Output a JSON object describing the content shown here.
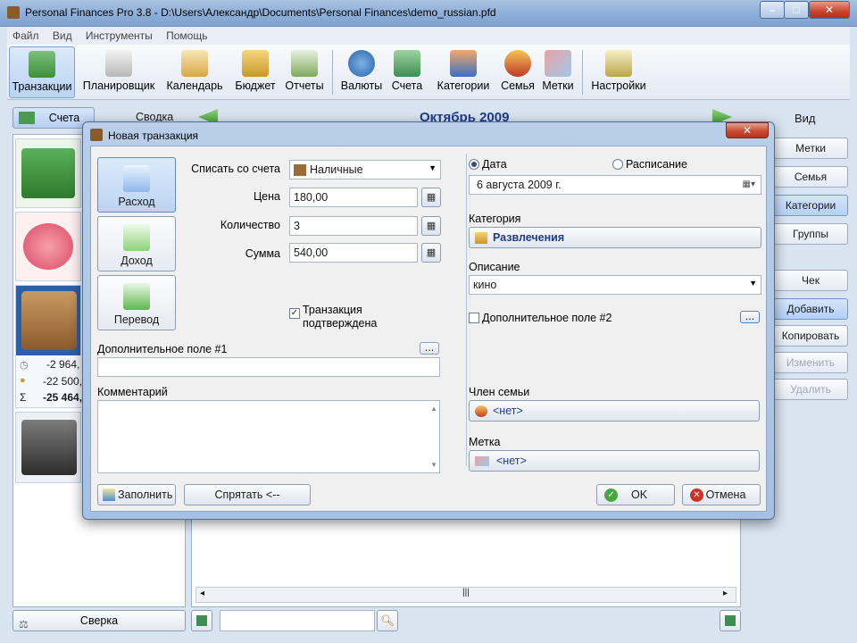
{
  "window": {
    "title": "Personal Finances Pro 3.8 - D:\\Users\\Александр\\Documents\\Personal Finances\\demo_russian.pfd"
  },
  "menu": [
    "Файл",
    "Вид",
    "Инструменты",
    "Помощь"
  ],
  "toolbar": [
    {
      "label": "Транзакции",
      "icon": "transactions-icon",
      "active": true
    },
    {
      "label": "Планировщик",
      "icon": "planner-icon"
    },
    {
      "label": "Календарь",
      "icon": "calendar-icon"
    },
    {
      "label": "Бюджет",
      "icon": "budget-icon"
    },
    {
      "label": "Отчеты",
      "icon": "reports-icon"
    },
    {
      "label": "Валюты",
      "icon": "currencies-icon"
    },
    {
      "label": "Счета",
      "icon": "accounts-icon"
    },
    {
      "label": "Категории",
      "icon": "categories-icon"
    },
    {
      "label": "Семья",
      "icon": "family-icon"
    },
    {
      "label": "Метки",
      "icon": "tags-icon"
    },
    {
      "label": "Настройки",
      "icon": "settings-icon"
    }
  ],
  "view_tabs": {
    "accounts": "Счета",
    "summary": "Сводка"
  },
  "period": {
    "month": "Октябрь 2009"
  },
  "left_panel": {
    "totals": [
      "-2 964,",
      "-22 500,",
      "-25 464,"
    ]
  },
  "right_panel": {
    "view_label": "Вид",
    "buttons": [
      "Метки",
      "Семья",
      "Категории",
      "Группы"
    ],
    "actions": [
      "Чек",
      "Добавить",
      "Копировать",
      "Изменить",
      "Удалить"
    ]
  },
  "bottom": {
    "reconcile": "Сверка",
    "search_placeholder": ""
  },
  "dialog": {
    "title": "Новая транзакция",
    "types": [
      "Расход",
      "Доход",
      "Перевод"
    ],
    "from_account_label": "Списать со счета",
    "from_account_value": "Наличные",
    "price_label": "Цена",
    "price_value": "180,00",
    "qty_label": "Количество",
    "qty_value": "3",
    "sum_label": "Сумма",
    "sum_value": "540,00",
    "confirmed_label_1": "Транзакция",
    "confirmed_label_2": "подтверждена",
    "extra1_label": "Дополнительное поле #1",
    "extra1_btn": "...",
    "comment_label": "Комментарий",
    "date_radio": "Дата",
    "schedule_radio": "Расписание",
    "date_value": "6  августа  2009 г.",
    "category_label": "Категория",
    "category_value": "Развлечения",
    "description_label": "Описание",
    "description_value": "кино",
    "extra2_label": "Дополнительное поле #2",
    "extra2_btn": "...",
    "family_label": "Член семьи",
    "family_value": "<нет>",
    "tag_label": "Метка",
    "tag_value": "<нет>",
    "fill_btn": "Заполнить",
    "hide_btn": "Спрятать <--",
    "ok_btn": "OK",
    "cancel_btn": "Отмена"
  },
  "colors": {
    "accent": "#1d3d8a",
    "selected_account": "#2c5fa6"
  }
}
